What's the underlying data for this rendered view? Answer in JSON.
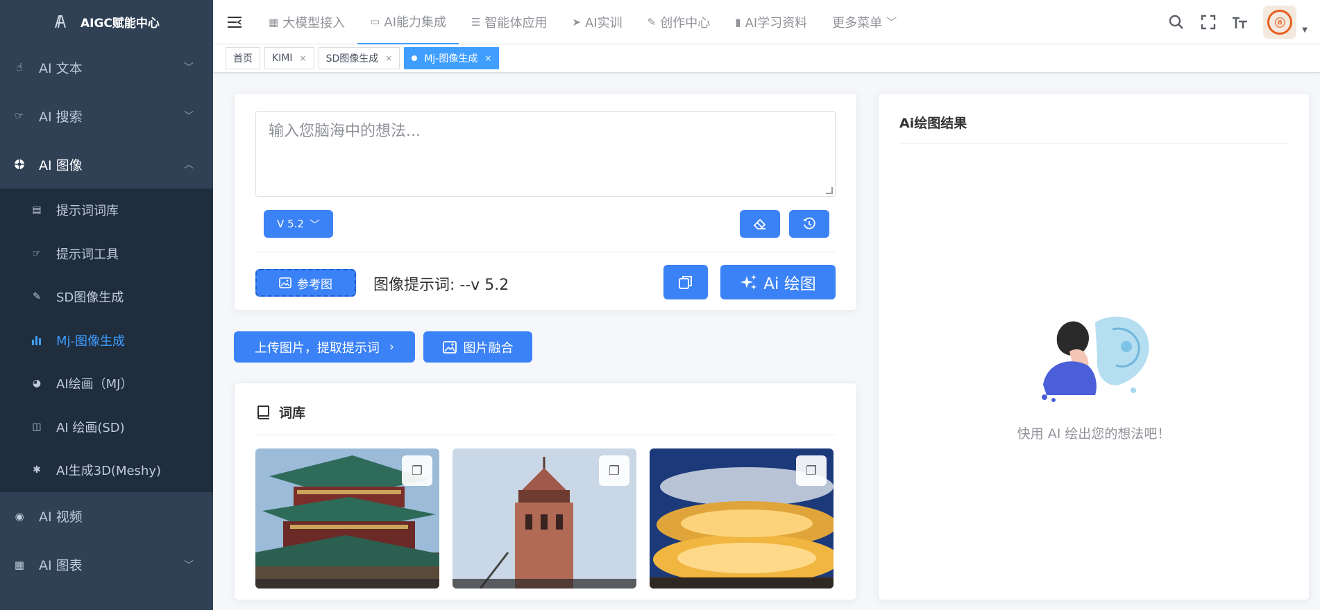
{
  "app": {
    "title": "AIGC赋能中心"
  },
  "sidebar": {
    "items": [
      {
        "label": "AI 文本",
        "icon": "hand-pointer-icon",
        "expanded": false
      },
      {
        "label": "AI 搜索",
        "icon": "hand-right-icon",
        "expanded": false
      },
      {
        "label": "AI 图像",
        "icon": "aperture-icon",
        "expanded": true,
        "children": [
          {
            "label": "提示词词库",
            "icon": "book-list-icon",
            "active": false
          },
          {
            "label": "提示词工具",
            "icon": "hand-right-icon",
            "active": false
          },
          {
            "label": "SD图像生成",
            "icon": "edit-square-icon",
            "active": false
          },
          {
            "label": "Mj-图像生成",
            "icon": "bar-chart-icon",
            "active": true
          },
          {
            "label": "AI绘画（MJ）",
            "icon": "globe-icon",
            "active": false
          },
          {
            "label": "AI 绘画(SD)",
            "icon": "columns-icon",
            "active": false
          },
          {
            "label": "AI生成3D(Meshy)",
            "icon": "bug-icon",
            "active": false
          }
        ]
      },
      {
        "label": "AI 视频",
        "icon": "record-icon",
        "expanded": false
      },
      {
        "label": "AI 图表",
        "icon": "calendar-icon",
        "expanded": false
      }
    ]
  },
  "topnav": {
    "items": [
      {
        "label": "大模型接入",
        "icon": "grid-icon",
        "active": false
      },
      {
        "label": "AI能力集成",
        "icon": "monitor-icon",
        "active": true
      },
      {
        "label": "智能体应用",
        "icon": "list-icon",
        "active": false
      },
      {
        "label": "AI实训",
        "icon": "paper-plane-icon",
        "active": false
      },
      {
        "label": "创作中心",
        "icon": "edit-icon",
        "active": false
      },
      {
        "label": "AI学习资料",
        "icon": "book-icon",
        "active": false
      },
      {
        "label": "更多菜单",
        "icon": "chevron-down-icon",
        "active": false
      }
    ]
  },
  "tags": [
    {
      "label": "首页",
      "closable": false,
      "active": false
    },
    {
      "label": "KIMI",
      "closable": true,
      "active": false
    },
    {
      "label": "SD图像生成",
      "closable": true,
      "active": false
    },
    {
      "label": "Mj-图像生成",
      "closable": true,
      "active": true
    }
  ],
  "prompt": {
    "placeholder": "输入您脑海中的想法...",
    "version_label": "V 5.2",
    "reference_label": "参考图",
    "prompt_text": "图像提示词: --v 5.2",
    "draw_label": "Ai 绘图"
  },
  "actions": {
    "upload_label": "上传图片，提取提示词",
    "merge_label": "图片融合"
  },
  "library": {
    "title": "词库",
    "thumbnails": [
      {
        "name": "pagoda"
      },
      {
        "name": "brick-tower"
      },
      {
        "name": "modern-building"
      }
    ]
  },
  "result": {
    "title": "Ai绘图结果",
    "empty_text": "快用 AI 绘出您的想法吧！"
  },
  "colors": {
    "sidebar_bg": "#304156",
    "submenu_bg": "#1f2d3d",
    "accent": "#409eff",
    "button_blue": "#3b82f6"
  }
}
